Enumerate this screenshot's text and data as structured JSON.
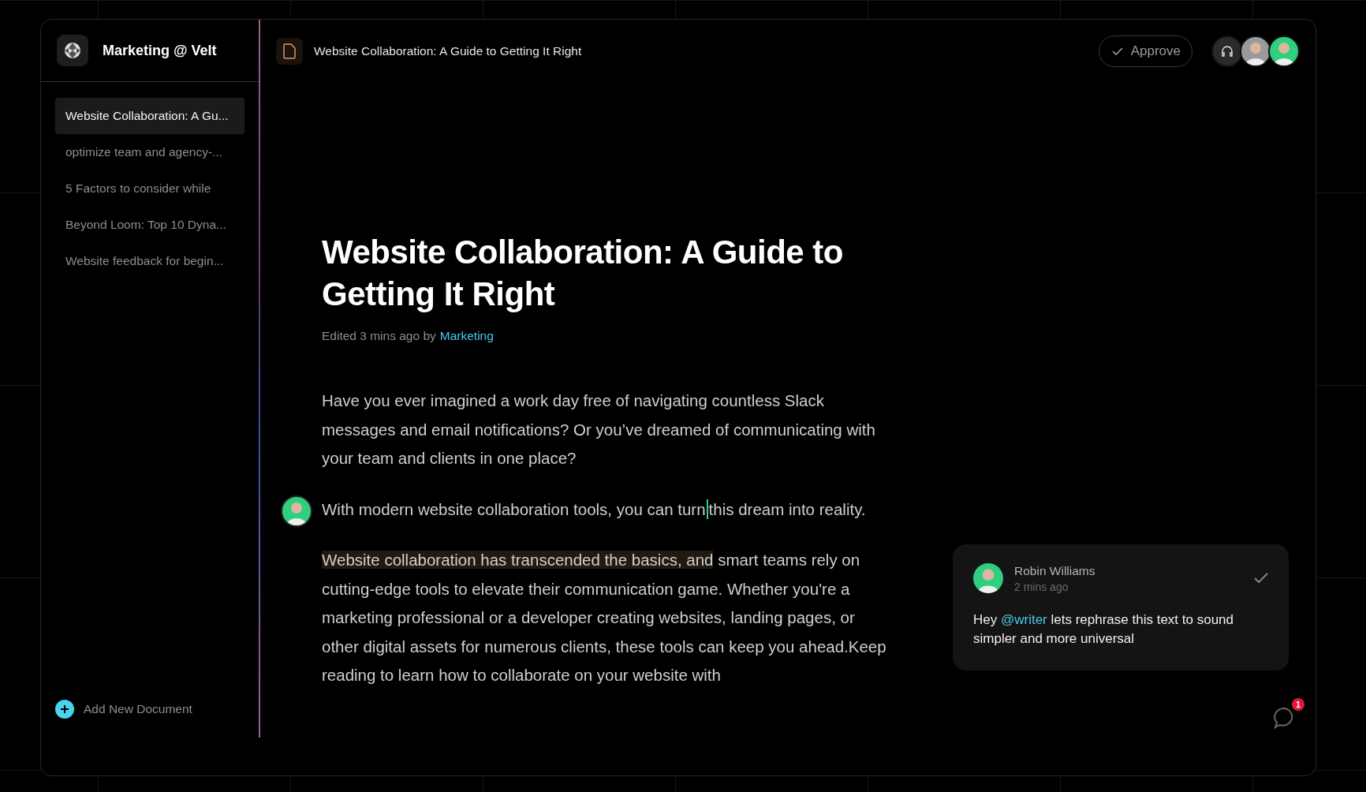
{
  "workspace": {
    "name": "Marketing @ Velt"
  },
  "documents": [
    {
      "title": "Website Collaboration: A Gu...",
      "selected": true
    },
    {
      "title": "optimize team and agency-...",
      "selected": false
    },
    {
      "title": "5 Factors to consider while",
      "selected": false
    },
    {
      "title": "Beyond Loom: Top 10 Dyna...",
      "selected": false
    },
    {
      "title": "Website feedback for begin...",
      "selected": false
    }
  ],
  "add_document": {
    "label": "Add New Document"
  },
  "header": {
    "doc_title": "Website Collaboration: A Guide to Getting It Right",
    "approve": "Approve",
    "participants": [
      {
        "kind": "huddle"
      },
      {
        "kind": "person",
        "color": "#9a9a9a"
      },
      {
        "kind": "person",
        "color": "#2fcf7f"
      }
    ]
  },
  "article": {
    "title": "Website Collaboration: A Guide to Getting It Right",
    "meta_prefix": "Edited 3 mins ago by",
    "meta_author": "Marketing",
    "paragraphs": [
      {
        "commented": false,
        "segments": [
          {
            "kind": "text",
            "text": "Have you ever imagined a work day free of navigating countless Slack messages and email notifications? Or you’ve dreamed of communicating with your team and clients in one place?"
          }
        ]
      },
      {
        "commented": true,
        "segments": [
          {
            "kind": "text",
            "text": "With modern website collaboration tools, you can turn"
          },
          {
            "kind": "cursor"
          },
          {
            "kind": "text",
            "text": "this dream into reality."
          }
        ]
      },
      {
        "commented": false,
        "segments": [
          {
            "kind": "highlight",
            "text": "Website collaboration has transcended the basics, and"
          },
          {
            "kind": "text",
            "text": " smart teams rely on cutting-edge tools to elevate their communication game. Whether you're a marketing professional or a developer creating websites, landing pages, or other digital assets for numerous clients, these tools can keep you ahead.Keep reading to learn how to collaborate on your website with"
          }
        ]
      }
    ]
  },
  "comment": {
    "author": "Robin Williams",
    "time": "2 mins ago",
    "resolved": true,
    "body": [
      {
        "kind": "text",
        "text": "Hey "
      },
      {
        "kind": "mention",
        "text": "@writer"
      },
      {
        "kind": "text",
        "text": " lets rephrase this text to sound simpler and more universal"
      }
    ]
  },
  "notifications": {
    "count": "1"
  }
}
